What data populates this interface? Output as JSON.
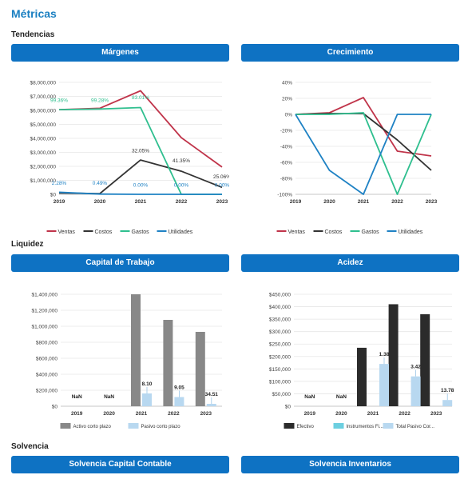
{
  "page": {
    "title": "Métricas",
    "sections": {
      "tendencias": "Tendencias",
      "liquidez": "Liquidez",
      "solvencia": "Solvencia"
    },
    "headers": {
      "margenes": "Márgenes",
      "crecimiento": "Crecimiento",
      "capital": "Capital de Trabajo",
      "acidez": "Acidez",
      "solv_capital": "Solvencia Capital Contable",
      "solv_inv": "Solvencia Inventarios"
    }
  },
  "colors": {
    "accent": "#0e72c3",
    "ventas": "#c0344a",
    "costos": "#333333",
    "gastos": "#2fbf8f",
    "utilidades": "#1f82c4"
  },
  "chart_data": [
    {
      "id": "margenes",
      "type": "line",
      "categories": [
        "2019",
        "2020",
        "2021",
        "2022",
        "2023"
      ],
      "ylim": [
        0,
        8000000
      ],
      "yticks": [
        "$0",
        "$1,000,000",
        "$2,000,000",
        "$3,000,000",
        "$4,000,000",
        "$5,000,000",
        "$6,000,000",
        "$7,000,000",
        "$8,000,000"
      ],
      "series": [
        {
          "name": "Ventas",
          "color": "#c0344a",
          "values": [
            6050000,
            6150000,
            7400000,
            4050000,
            1950000
          ]
        },
        {
          "name": "Costos",
          "color": "#333333",
          "values": [
            100000,
            50000,
            2450000,
            1650000,
            500000
          ]
        },
        {
          "name": "Gastos",
          "color": "#2fbf8f",
          "values": [
            6050000,
            6100000,
            6200000,
            0,
            0
          ]
        },
        {
          "name": "Utilidades",
          "color": "#1f82c4",
          "values": [
            150000,
            20000,
            0,
            0,
            0
          ]
        }
      ],
      "annotations": [
        {
          "i": 0,
          "y": 6600000,
          "text": "99.36%",
          "color": "#2fbf8f"
        },
        {
          "i": 1,
          "y": 6600000,
          "text": "99.28%",
          "color": "#2fbf8f"
        },
        {
          "i": 2,
          "y": 6800000,
          "text": "83.01%",
          "color": "#2fbf8f"
        },
        {
          "i": 2,
          "y": 3000000,
          "text": "32.05%",
          "color": "#333333"
        },
        {
          "i": 3,
          "y": 2300000,
          "text": "41.35%",
          "color": "#333333"
        },
        {
          "i": 4,
          "y": 1150000,
          "text": "25.06%",
          "color": "#333333"
        },
        {
          "i": 0,
          "y": 700000,
          "text": "2.28%",
          "color": "#1f82c4"
        },
        {
          "i": 1,
          "y": 700000,
          "text": "0.49%",
          "color": "#1f82c4"
        },
        {
          "i": 2,
          "y": 550000,
          "text": "0.00%",
          "color": "#1f82c4"
        },
        {
          "i": 3,
          "y": 550000,
          "text": "0.00%",
          "color": "#1f82c4"
        },
        {
          "i": 4,
          "y": 550000,
          "text": "0.00%",
          "color": "#1f82c4"
        }
      ]
    },
    {
      "id": "crecimiento",
      "type": "line",
      "categories": [
        "2019",
        "2020",
        "2021",
        "2022",
        "2023"
      ],
      "ylim": [
        -100,
        40
      ],
      "yticks": [
        "-100%",
        "-80%",
        "-60%",
        "-40%",
        "-20%",
        "0%",
        "20%",
        "40%"
      ],
      "series": [
        {
          "name": "Ventas",
          "color": "#c0344a",
          "values": [
            0,
            2,
            21,
            -46,
            -52
          ]
        },
        {
          "name": "Costos",
          "color": "#333333",
          "values": [
            0,
            1,
            1,
            -32,
            -70
          ]
        },
        {
          "name": "Gastos",
          "color": "#2fbf8f",
          "values": [
            0,
            0,
            2,
            -100,
            0
          ]
        },
        {
          "name": "Utilidades",
          "color": "#1f82c4",
          "values": [
            0,
            -70,
            -100,
            0,
            0
          ]
        }
      ]
    },
    {
      "id": "capital",
      "type": "bar",
      "categories": [
        "2019",
        "2020",
        "2021",
        "2022",
        "2023"
      ],
      "ylim": [
        0,
        1400000
      ],
      "yticks": [
        "$0",
        "$200,000",
        "$400,000",
        "$600,000",
        "$800,000",
        "$1,000,000",
        "$1,200,000",
        "$1,400,000"
      ],
      "series": [
        {
          "name": "Activo corto plazo",
          "color": "#888888",
          "values": [
            0,
            0,
            1400000,
            1080000,
            930000
          ]
        },
        {
          "name": "Pasivo corto plazo",
          "color": "#b8d8f0",
          "values": [
            0,
            0,
            160000,
            115000,
            30000
          ]
        }
      ],
      "labels": [
        "NaN",
        "NaN",
        "8.10",
        "9.05",
        "34.51"
      ]
    },
    {
      "id": "acidez",
      "type": "bar",
      "categories": [
        "2019",
        "2020",
        "2021",
        "2022",
        "2023"
      ],
      "ylim": [
        0,
        450000
      ],
      "yticks": [
        "$0",
        "$50,000",
        "$100,000",
        "$150,000",
        "$200,000",
        "$250,000",
        "$300,000",
        "$350,000",
        "$400,000",
        "$450,000"
      ],
      "series": [
        {
          "name": "Efectivo",
          "color": "#2b2b2b",
          "values": [
            0,
            0,
            235000,
            410000,
            370000
          ]
        },
        {
          "name": "Instrumentos Fi...",
          "color": "#6ccfe0",
          "values": [
            0,
            0,
            0,
            0,
            0
          ]
        },
        {
          "name": "Total Pasivo Cor...",
          "color": "#b8d8f0",
          "values": [
            0,
            0,
            170000,
            120000,
            25000
          ]
        }
      ],
      "labels": [
        "NaN",
        "NaN",
        "1.38",
        "3.42",
        "13.78"
      ]
    }
  ]
}
